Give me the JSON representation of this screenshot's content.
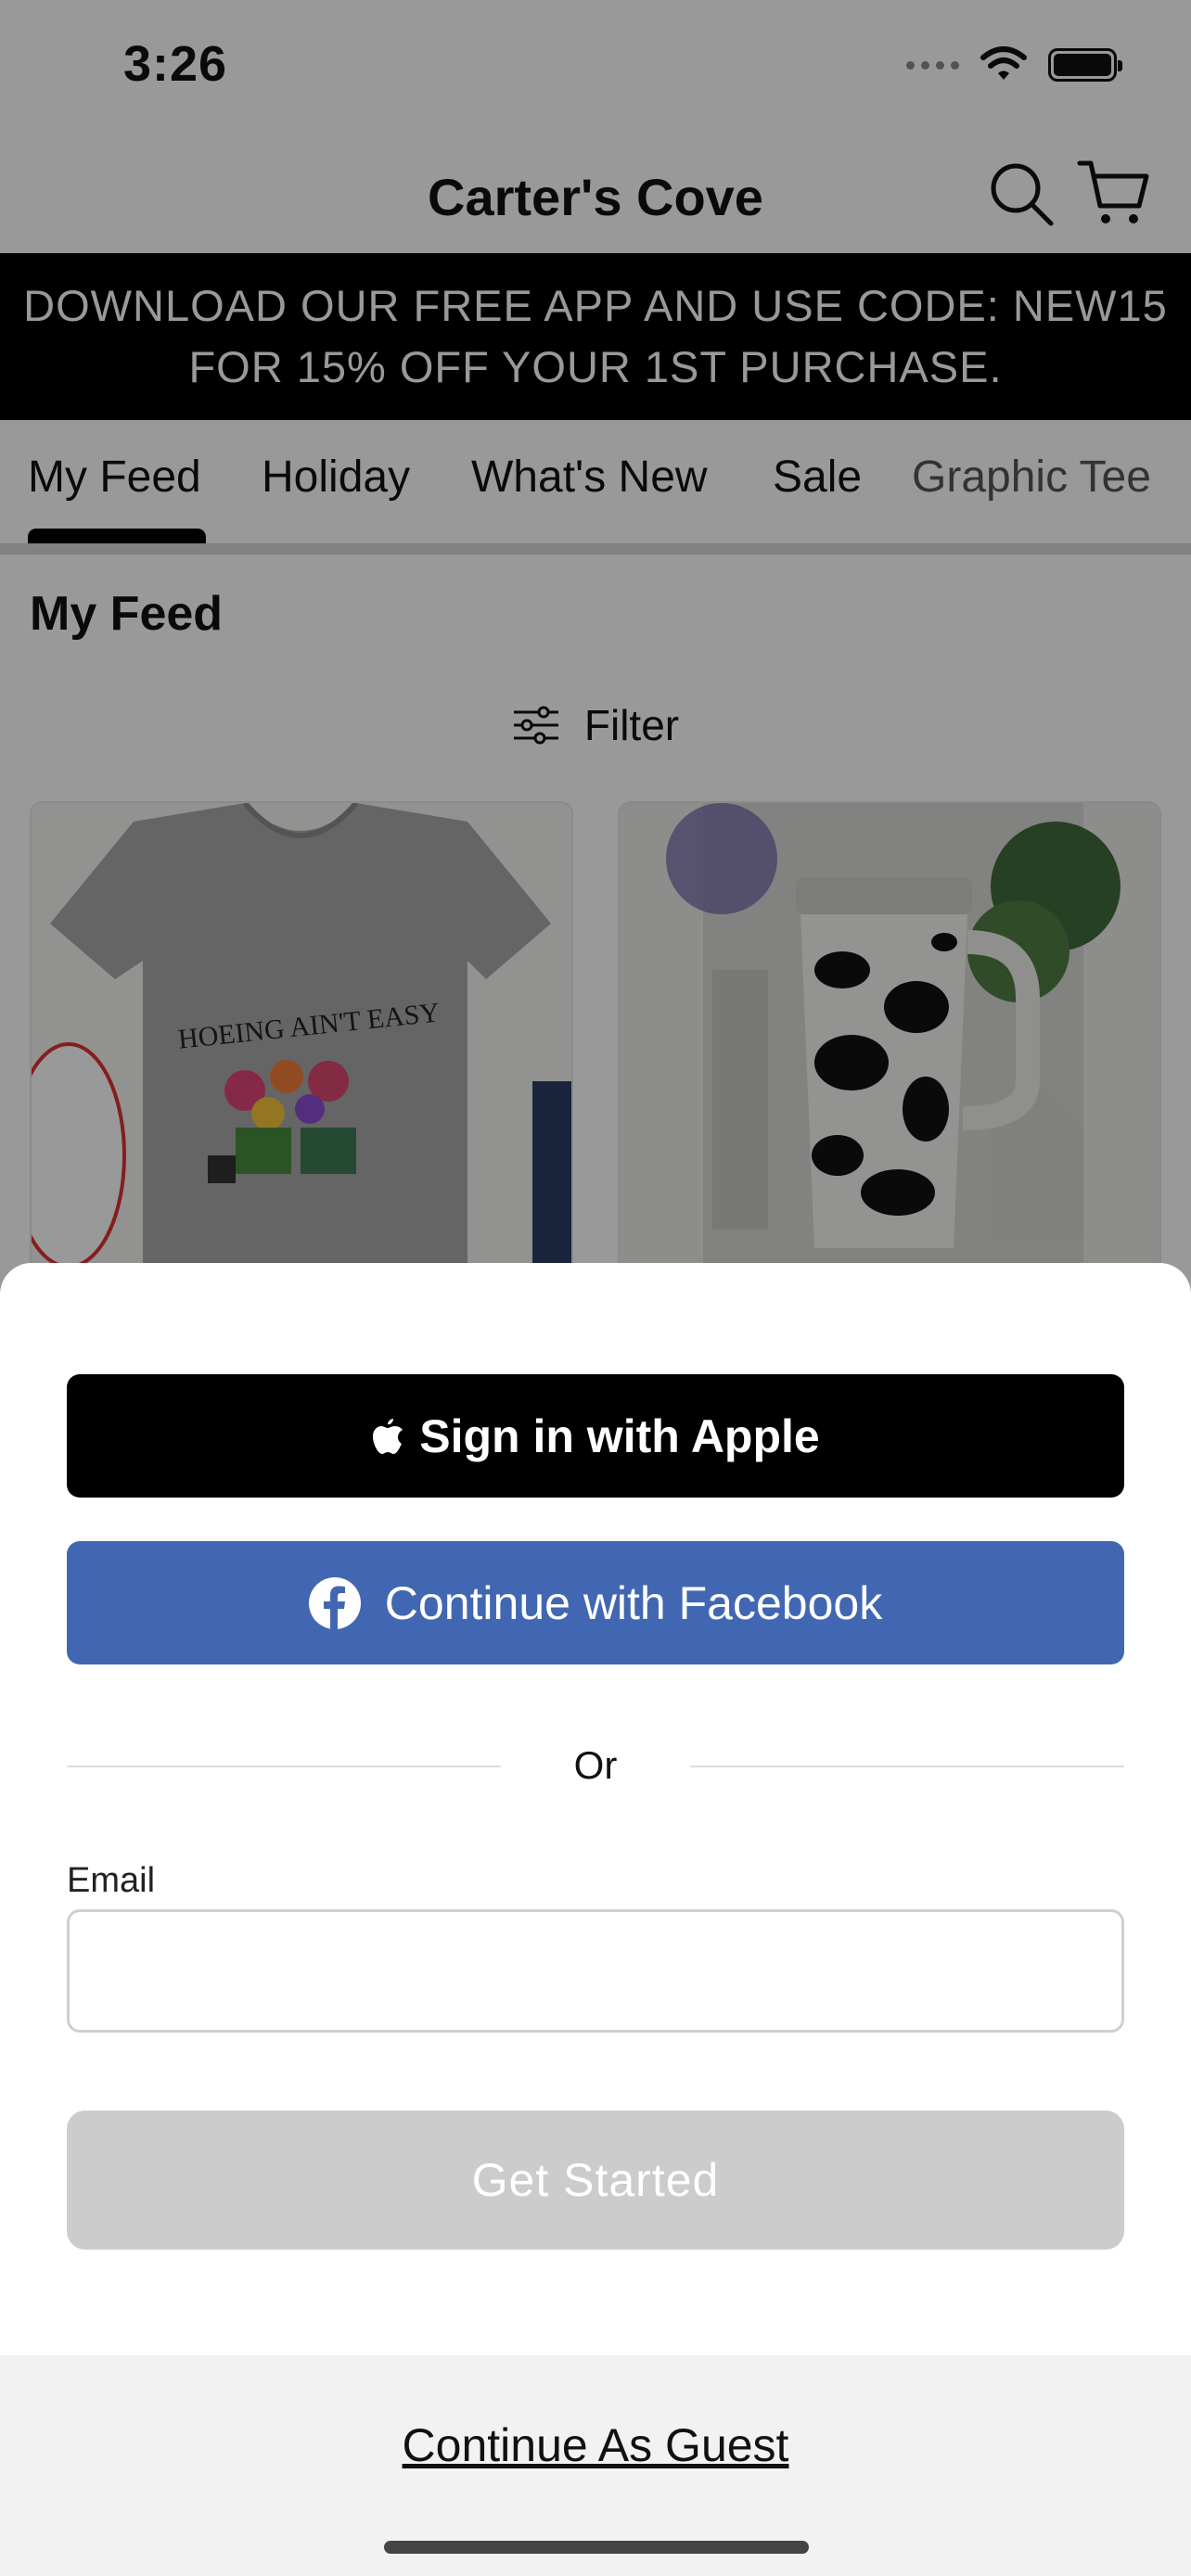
{
  "status_bar": {
    "time": "3:26"
  },
  "header": {
    "title": "Carter's Cove",
    "search_icon": "search-icon",
    "cart_icon": "cart-icon"
  },
  "promo": {
    "line1": "DOWNLOAD OUR FREE APP AND USE CODE: NEW15",
    "line2": "FOR 15% OFF YOUR 1ST PURCHASE."
  },
  "tabs": [
    {
      "label": "My Feed",
      "selected": true
    },
    {
      "label": "Holiday"
    },
    {
      "label": "What's New"
    },
    {
      "label": "Sale"
    },
    {
      "label": "Graphic Tee"
    }
  ],
  "feed": {
    "heading": "My Feed",
    "filter_label": "Filter",
    "products": [
      {
        "image": "gray-v-neck-tee-with-flowers",
        "print": "HOEING AIN'T EASY"
      },
      {
        "image": "cow-print-tumbler"
      }
    ]
  },
  "sheet": {
    "apple_button": "Sign in with Apple",
    "facebook_button": "Continue with Facebook",
    "divider_text": "Or",
    "email_label": "Email",
    "email_value": "",
    "get_started_button": "Get Started",
    "guest_link": "Continue As Guest"
  },
  "colors": {
    "facebook_blue": "#4267b2",
    "disabled_gray": "#cccccc",
    "overlay": "rgba(0,0,0,0.40)"
  }
}
